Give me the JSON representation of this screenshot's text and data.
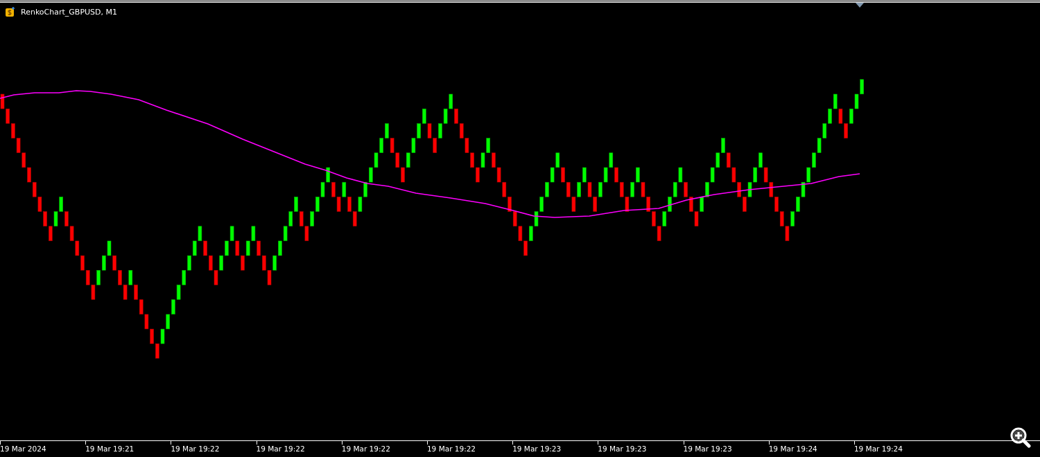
{
  "window": {
    "title": "RenkoChart_GBPUSD, M1"
  },
  "time_axis": {
    "labels": [
      "19 Mar 2024",
      "19 Mar 19:21",
      "19 Mar 19:22",
      "19 Mar 19:22",
      "19 Mar 19:22",
      "19 Mar 19:22",
      "19 Mar 19:23",
      "19 Mar 19:23",
      "19 Mar 19:23",
      "19 Mar 19:24",
      "19 Mar 19:24"
    ]
  }
}
